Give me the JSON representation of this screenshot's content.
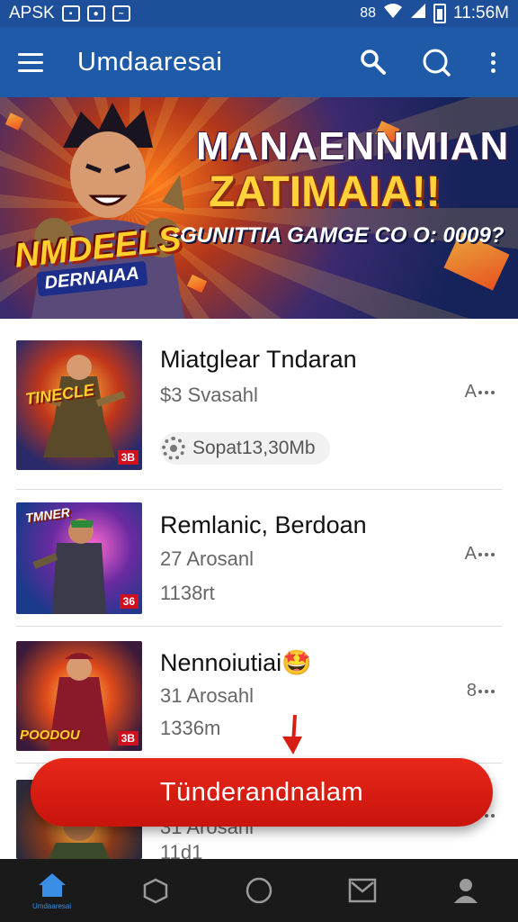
{
  "status_bar": {
    "carrier": "APSK",
    "time": "11:56M"
  },
  "app_bar": {
    "title": "Umdaaresai"
  },
  "banner": {
    "headline_line1": "MANAENNMIAN",
    "headline_line2": "ZATIMAIA!!",
    "subtitle": "PGUNITTIA GAMGE CO O: 0009?",
    "logo_line1": "NMDEELS",
    "logo_line2": "DERNAIAA"
  },
  "list": {
    "items": [
      {
        "title": "Miatglear Tndaran",
        "line2": "$3 Svasahl",
        "line3": "",
        "chip": "Sopat13,30Mb",
        "right": "A",
        "thumb_text": "TINECLE",
        "thumb_tag": "3B"
      },
      {
        "title": "Remlanic, Berdoan",
        "line2": "27 Arosanl",
        "line3": "1138rt",
        "right": "A",
        "thumb_text": "TMNER",
        "thumb_tag": "36"
      },
      {
        "title": "Nennoiutiai",
        "title_emoji": "🤩",
        "line2": "31 Arosahl",
        "line3": "1336m",
        "right": "8",
        "thumb_text": "POODOU",
        "thumb_tag": "3B"
      },
      {
        "title": "",
        "line2": "31 Arosahl",
        "line3": "11d1",
        "right": "",
        "thumb_text": "",
        "thumb_tag": ""
      }
    ]
  },
  "cta": {
    "label": "Tünderandnalam"
  },
  "bottom_nav": {
    "items": [
      {
        "icon": "home-icon",
        "label": "Umdaaresai",
        "active": true
      },
      {
        "icon": "cube-icon",
        "label": "",
        "active": false
      },
      {
        "icon": "circle-icon",
        "label": "",
        "active": false
      },
      {
        "icon": "mail-icon",
        "label": "",
        "active": false
      },
      {
        "icon": "person-icon",
        "label": "",
        "active": false
      }
    ]
  },
  "colors": {
    "primary": "#1e5aa8",
    "status_bar": "#1d4f9a",
    "cta": "#d81e14",
    "nav_background": "#1a1a1a",
    "nav_active": "#3a8ee6"
  }
}
